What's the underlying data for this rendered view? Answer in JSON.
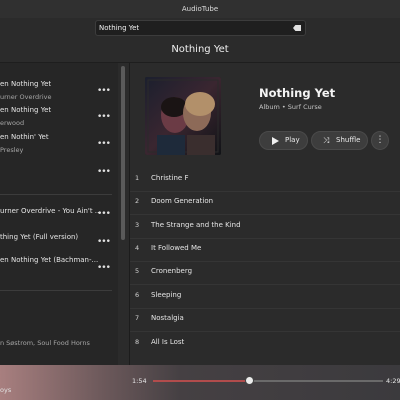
{
  "app": {
    "title": "AudioTube"
  },
  "search": {
    "value": "Nothing Yet"
  },
  "page": {
    "title": "Nothing Yet"
  },
  "left_list": {
    "items": [
      {
        "title": "en Nothing Yet",
        "subtitle": "urner Overdrive"
      },
      {
        "title": "en Nothing Yet",
        "subtitle": "erwood"
      },
      {
        "title": "en Nothin' Yet",
        "subtitle": "Presley"
      },
      {
        "title": "urner Overdrive - You Ain't ...",
        "subtitle": ""
      },
      {
        "title": "thing Yet (Full version)",
        "subtitle": ""
      },
      {
        "title": "en Nothing Yet (Bachman-...",
        "subtitle": ""
      },
      {
        "title": "n Søstrom, Soul Food Horns",
        "subtitle": ""
      }
    ]
  },
  "album": {
    "title": "Nothing Yet",
    "subtitle": "Album • Surf Curse",
    "play_label": "Play",
    "shuffle_label": "Shuffle"
  },
  "tracks": [
    {
      "num": "1",
      "name": "Christine F"
    },
    {
      "num": "2",
      "name": "Doom Generation"
    },
    {
      "num": "3",
      "name": "The Strange and the Kind"
    },
    {
      "num": "4",
      "name": "It Followed Me"
    },
    {
      "num": "5",
      "name": "Cronenberg"
    },
    {
      "num": "6",
      "name": "Sleeping"
    },
    {
      "num": "7",
      "name": "Nostalgia"
    },
    {
      "num": "8",
      "name": "All Is Lost"
    }
  ],
  "player": {
    "artist": "oys",
    "elapsed": "1:54",
    "duration": "4:29",
    "progress": 0.42
  },
  "colors": {
    "accent": "#b14c4c",
    "background": "#2b2b2b"
  }
}
